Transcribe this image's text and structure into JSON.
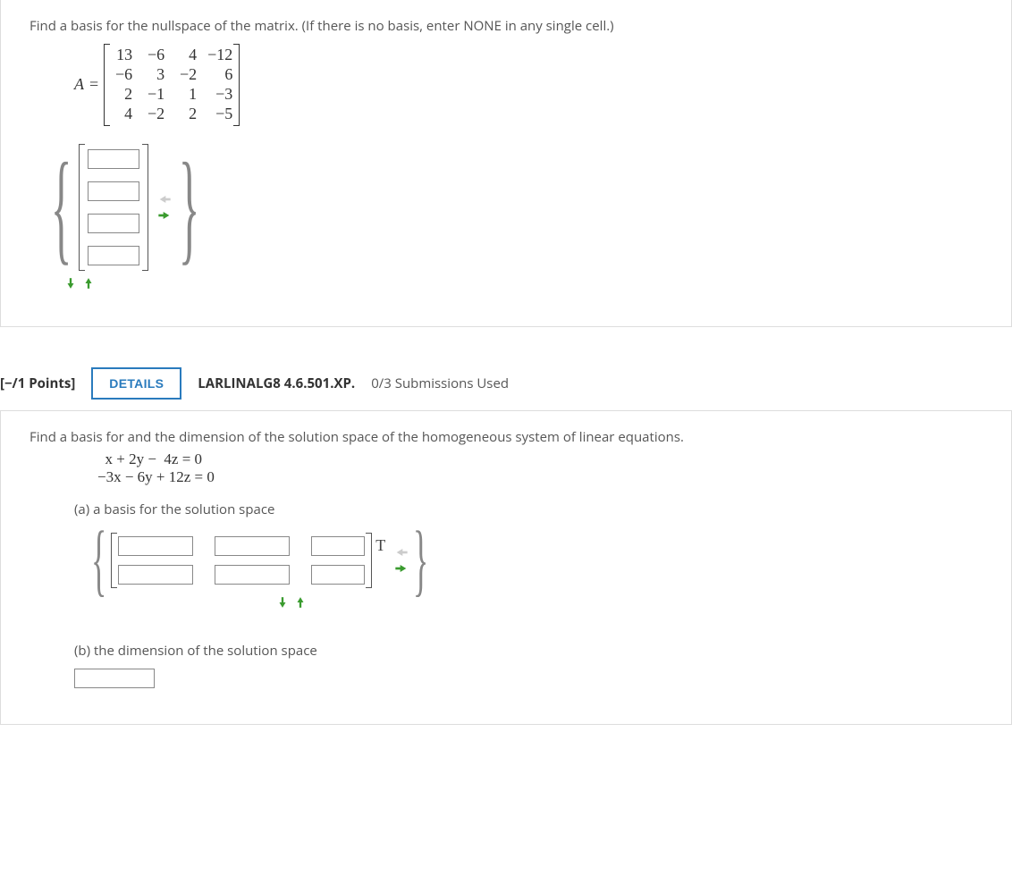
{
  "q1": {
    "prompt": "Find a basis for the nullspace of the matrix. (If there is no basis, enter NONE in any single cell.)",
    "matrix_label_lhs": "A",
    "matrix_label_eq": "=",
    "matrix": [
      [
        "13",
        "−6",
        "4",
        "−12"
      ],
      [
        "−6",
        "3",
        "−2",
        "6"
      ],
      [
        "2",
        "−1",
        "1",
        "−3"
      ],
      [
        "4",
        "−2",
        "2",
        "−5"
      ]
    ]
  },
  "header2": {
    "points": "[−/1 Points]",
    "details": "DETAILS",
    "code": "LARLINALG8 4.6.501.XP.",
    "subs": "0/3 Submissions Used"
  },
  "q2": {
    "prompt": "Find a basis for and the dimension of the solution space of the homogeneous system of linear equations.",
    "eq_line1": "  x + 2y −  4z = 0",
    "eq_line2": "−3x − 6y + 12z = 0",
    "part_a": "(a) a basis for the solution space",
    "part_b": "(b) the dimension of the solution space"
  }
}
